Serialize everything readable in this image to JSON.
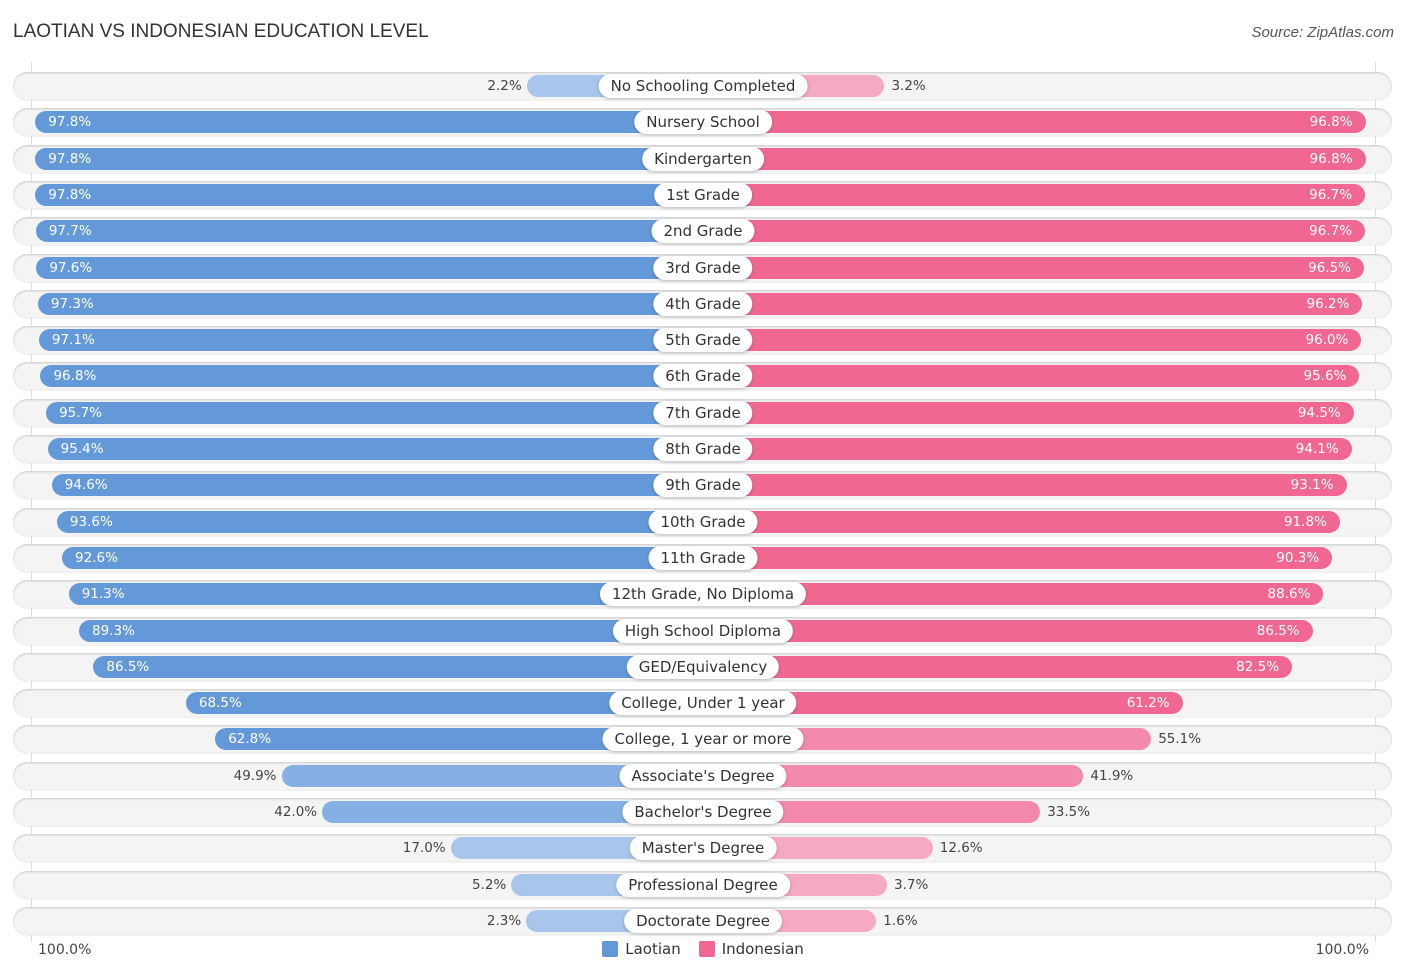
{
  "header": {
    "title": "LAOTIAN VS INDONESIAN EDUCATION LEVEL",
    "source": "Source: ZipAtlas.com"
  },
  "colors": {
    "laotian": "#6499d9",
    "laotian_light": "#a8c6ec",
    "indonesian": "#f06892",
    "indonesian_light": "#f6a9c2"
  },
  "chart_data": {
    "type": "bar",
    "orientation": "horizontal-diverging",
    "title": "LAOTIAN VS INDONESIAN EDUCATION LEVEL",
    "categories": [
      "No Schooling Completed",
      "Nursery School",
      "Kindergarten",
      "1st Grade",
      "2nd Grade",
      "3rd Grade",
      "4th Grade",
      "5th Grade",
      "6th Grade",
      "7th Grade",
      "8th Grade",
      "9th Grade",
      "10th Grade",
      "11th Grade",
      "12th Grade, No Diploma",
      "High School Diploma",
      "GED/Equivalency",
      "College, Under 1 year",
      "College, 1 year or more",
      "Associate's Degree",
      "Bachelor's Degree",
      "Master's Degree",
      "Professional Degree",
      "Doctorate Degree"
    ],
    "series": [
      {
        "name": "Laotian",
        "values": [
          2.2,
          97.8,
          97.8,
          97.8,
          97.7,
          97.6,
          97.3,
          97.1,
          96.8,
          95.7,
          95.4,
          94.6,
          93.6,
          92.6,
          91.3,
          89.3,
          86.5,
          68.5,
          62.8,
          49.9,
          42.0,
          17.0,
          5.2,
          2.3
        ]
      },
      {
        "name": "Indonesian",
        "values": [
          3.2,
          96.8,
          96.8,
          96.7,
          96.7,
          96.5,
          96.2,
          96.0,
          95.6,
          94.5,
          94.1,
          93.1,
          91.8,
          90.3,
          88.6,
          86.5,
          82.5,
          61.2,
          55.1,
          41.9,
          33.5,
          12.6,
          3.7,
          1.6
        ]
      }
    ],
    "value_labels_left": [
      "2.2%",
      "97.8%",
      "97.8%",
      "97.8%",
      "97.7%",
      "97.6%",
      "97.3%",
      "97.1%",
      "96.8%",
      "95.7%",
      "95.4%",
      "94.6%",
      "93.6%",
      "92.6%",
      "91.3%",
      "89.3%",
      "86.5%",
      "68.5%",
      "62.8%",
      "49.9%",
      "42.0%",
      "17.0%",
      "5.2%",
      "2.3%"
    ],
    "value_labels_right": [
      "3.2%",
      "96.8%",
      "96.8%",
      "96.7%",
      "96.7%",
      "96.5%",
      "96.2%",
      "96.0%",
      "95.6%",
      "94.5%",
      "94.1%",
      "93.1%",
      "91.8%",
      "90.3%",
      "88.6%",
      "86.5%",
      "82.5%",
      "61.2%",
      "55.1%",
      "41.9%",
      "33.5%",
      "12.6%",
      "3.7%",
      "1.6%"
    ],
    "axis": {
      "left_label": "100.0%",
      "right_label": "100.0%",
      "range": [
        0,
        100
      ]
    },
    "legend": {
      "position": "bottom-center",
      "entries": [
        "Laotian",
        "Indonesian"
      ]
    }
  }
}
